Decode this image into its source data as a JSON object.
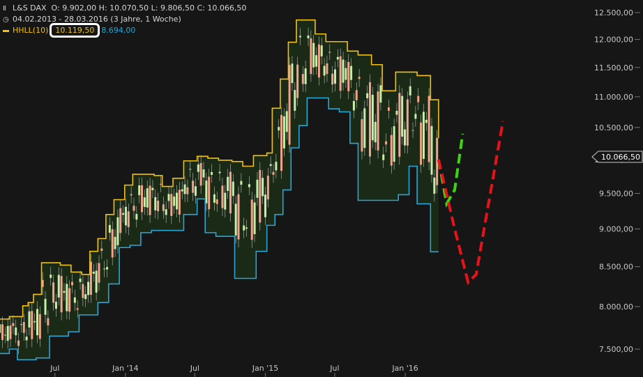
{
  "header": {
    "symbol_icon": "bars-icon",
    "clock_icon": "clock-icon",
    "title": "L&S DAX",
    "ohlc": "O: 9.902,00  H: 10.070,50  L: 9.806,50  C: 10.066,50",
    "range": "04.02.2013 - 28.03.2016 (3 Jahre, 1 Woche)",
    "indicator_name": "HHLL(10)",
    "indicator_high": "10.119,50",
    "indicator_low": "8.694,00"
  },
  "colors": {
    "background": "#161616",
    "upper_band": "#f2c20f",
    "lower_band": "#2aa6d6",
    "band_fill": "#1b2a16",
    "candle_up": "#c8ecaa",
    "candle_down": "#f0a48c",
    "wick": "#c0c0c0",
    "green_projection": "#3ed313",
    "red_projection": "#e8121b",
    "price_marker": "#ffffff"
  },
  "chart_data": {
    "type": "line",
    "title": "L&S DAX",
    "ylim": [
      7350,
      12550
    ],
    "yscale": "log",
    "x_range": [
      "2013-02-04",
      "2016-05-20"
    ],
    "y_ticks": [
      7500,
      8000,
      8500,
      9000,
      9500,
      10000,
      10500,
      11000,
      11500,
      12000,
      12500
    ],
    "y_tick_labels": [
      "7.500,00",
      "8.000,00",
      "8.500,00",
      "9.000,00",
      "9.500,00",
      "10.000,00",
      "10.500,00",
      "11.000,00",
      "11.500,00",
      "12.000,00",
      "12.500,00"
    ],
    "x_ticks": [
      "2013-07-01",
      "2014-01-01",
      "2014-07-01",
      "2015-01-01",
      "2015-07-01",
      "2016-01-01"
    ],
    "x_tick_labels": [
      "Jul",
      "Jan '14",
      "Jul",
      "Jan '15",
      "Jul",
      "Jan '16"
    ],
    "last_price": 10066.5,
    "last_price_label": "10.066,50",
    "series": [
      {
        "name": "HHLL(10) high",
        "x": [
          "2013-02-04",
          "2013-03-04",
          "2013-04-08",
          "2013-04-22",
          "2013-05-06",
          "2013-05-27",
          "2013-06-17",
          "2013-07-15",
          "2013-08-12",
          "2013-09-09",
          "2013-09-30",
          "2013-10-21",
          "2013-11-11",
          "2013-12-02",
          "2013-12-30",
          "2014-01-20",
          "2014-02-17",
          "2014-03-17",
          "2014-04-07",
          "2014-05-05",
          "2014-06-02",
          "2014-07-07",
          "2014-08-04",
          "2014-09-01",
          "2014-10-06",
          "2014-11-03",
          "2014-12-01",
          "2015-01-05",
          "2015-01-19",
          "2015-02-09",
          "2015-03-02",
          "2015-03-23",
          "2015-04-13",
          "2015-05-11",
          "2015-06-08",
          "2015-07-06",
          "2015-08-03",
          "2015-08-31",
          "2015-10-05",
          "2015-11-02",
          "2015-12-07",
          "2016-01-04",
          "2016-02-01",
          "2016-03-07",
          "2016-03-28"
        ],
        "values": [
          7850,
          7880,
          8010,
          8050,
          8150,
          8550,
          8550,
          8520,
          8430,
          8400,
          8700,
          8870,
          9200,
          9410,
          9620,
          9780,
          9780,
          9760,
          9600,
          9720,
          9980,
          10050,
          10020,
          9990,
          9970,
          9900,
          10060,
          10100,
          10810,
          11300,
          11950,
          12360,
          12360,
          12100,
          11960,
          11960,
          11790,
          11720,
          11550,
          11100,
          11420,
          11420,
          11360,
          10950,
          10330
        ]
      },
      {
        "name": "HHLL(10) low",
        "x": [
          "2013-02-04",
          "2013-03-04",
          "2013-03-25",
          "2013-04-15",
          "2013-05-13",
          "2013-06-17",
          "2013-07-15",
          "2013-08-05",
          "2013-09-02",
          "2013-09-23",
          "2013-10-21",
          "2013-11-18",
          "2013-12-16",
          "2014-01-13",
          "2014-02-10",
          "2014-03-10",
          "2014-04-07",
          "2014-05-05",
          "2014-06-02",
          "2014-07-07",
          "2014-07-28",
          "2014-08-25",
          "2014-09-22",
          "2014-10-13",
          "2014-11-10",
          "2014-12-08",
          "2015-01-05",
          "2015-01-26",
          "2015-02-16",
          "2015-03-09",
          "2015-03-30",
          "2015-04-20",
          "2015-05-18",
          "2015-06-15",
          "2015-07-13",
          "2015-08-10",
          "2015-08-31",
          "2015-10-05",
          "2015-11-02",
          "2015-11-23",
          "2015-12-14",
          "2016-01-11",
          "2016-02-01",
          "2016-03-07",
          "2016-03-28"
        ],
        "values": [
          7450,
          7500,
          7380,
          7380,
          7400,
          7650,
          7650,
          7700,
          7900,
          7900,
          8050,
          8280,
          8750,
          8780,
          8950,
          8980,
          8980,
          8980,
          9200,
          9420,
          8950,
          8900,
          8900,
          8350,
          8350,
          8700,
          9050,
          9200,
          9550,
          10180,
          10530,
          10980,
          10980,
          10800,
          10750,
          10250,
          9400,
          9400,
          9400,
          9400,
          9480,
          9900,
          9350,
          8694,
          8694
        ]
      },
      {
        "name": "Projection green",
        "x": [
          "2016-03-28",
          "2016-04-18",
          "2016-05-09",
          "2016-05-30"
        ],
        "values": [
          10000,
          9350,
          9550,
          10400
        ]
      },
      {
        "name": "Projection red",
        "x": [
          "2016-03-28",
          "2016-05-09",
          "2016-06-13",
          "2016-07-04",
          "2016-09-12"
        ],
        "values": [
          10000,
          9000,
          8300,
          8400,
          10600
        ]
      }
    ]
  }
}
